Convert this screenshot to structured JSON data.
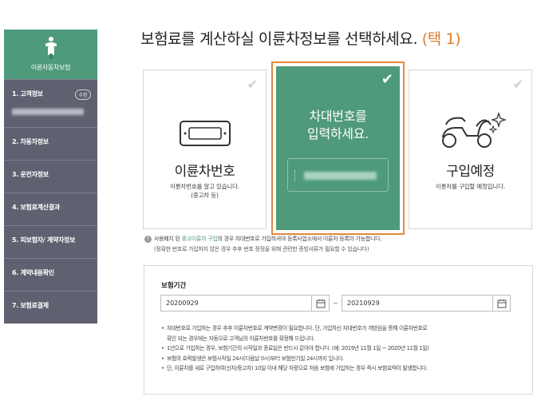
{
  "sidebar": {
    "brand": "이륜자동차보험",
    "items": [
      {
        "label": "1. 고객정보",
        "badge": "수정"
      },
      {
        "label": "2. 차동차정보"
      },
      {
        "label": "3. 운전자정보"
      },
      {
        "label": "4. 보험료계산결과"
      },
      {
        "label": "5. 피보험자/ 계약자정보"
      },
      {
        "label": "6. 계약내용확인"
      },
      {
        "label": "7. 보험료결제"
      }
    ]
  },
  "main": {
    "title": "보험료를 계산하실 이륜차정보를 선택하세요.",
    "title_pick": "(택 1)",
    "cards": [
      {
        "title": "이륜차번호",
        "desc_line1": "이륜차번호를 알고 있습니다.",
        "desc_line2": "(중고차 등)"
      },
      {
        "prompt_line1": "차대번호를",
        "prompt_line2": "입력하세요."
      },
      {
        "title": "구입예정",
        "desc_line1": "이륜차를 구입할 예정입니다."
      }
    ],
    "notice_prefix": "사용폐지 된",
    "notice_highlight": "중고이륜차 구입",
    "notice_rest": "의 경우 차대번호로 가입하셔야 등록사업소에서 이륜차 등록이 가능합니다.",
    "notice_sub": "(정확한 번호로 가입하지 않은 경우 추후 번호 정정을 위해 관련한 증빙서류가 필요할 수 있습니다)"
  },
  "period": {
    "label": "보험기간",
    "start": "20200929",
    "end": "20210929",
    "separator": "~",
    "bullets": [
      {
        "line1": "차대번호로 가입하는 경우 추후 이륜차번호로 계약변경이 필요합니다. 단, 가입하신 차대번호가 개방원을 통해 이륜차번호로",
        "line2": "확인 되는 경우에는 자동으로 고객님의 이륜차번호를 확정해 드립니다."
      },
      {
        "line1": "1년으로 가입하는 경우, 보험기간의 시작일과 종료일은 반드시 같아야 합니다. (예: 2019년 11월 1일 ~ 2020년 11월 1일)"
      },
      {
        "line1": "보험의 효력발생은 보험시작일 24시(다음날 0시)부터 보험만기일 24시까지 입니다."
      },
      {
        "line1": "단, 이륜차를 새로 구입하여(신차/중고차) 10일 이내 해당 차량으로 처음 보험에 가입하는 경우 즉시 보험효력이 발생합니다."
      }
    ]
  }
}
